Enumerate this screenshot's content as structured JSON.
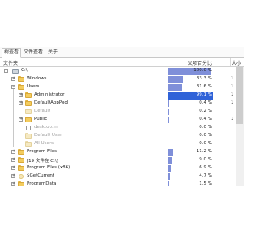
{
  "tabs": [
    "树查看",
    "文件查看",
    "关于"
  ],
  "columns": {
    "folder": "文件夹",
    "parent_pct": "父项百分比",
    "size": "大小"
  },
  "rows": [
    {
      "name": "C:\\",
      "pct": "100.0 %",
      "fraction": 1.0,
      "size": "",
      "icon": "drive-icon",
      "indent": 0,
      "expander": "−",
      "selected": false,
      "faded": false
    },
    {
      "name": "Windows",
      "pct": "33.3 %",
      "fraction": 0.333,
      "size": "1",
      "icon": "folder-icon",
      "indent": 1,
      "expander": "+",
      "selected": false,
      "faded": false
    },
    {
      "name": "Users",
      "pct": "31.6 %",
      "fraction": 0.316,
      "size": "1",
      "icon": "folder-icon",
      "indent": 1,
      "expander": "−",
      "selected": false,
      "faded": false
    },
    {
      "name": "Administrator",
      "pct": "99.1 %",
      "fraction": 0.991,
      "size": "1",
      "icon": "folder-icon",
      "indent": 2,
      "expander": "+",
      "selected": true,
      "faded": false
    },
    {
      "name": "DefaultAppPool",
      "pct": "0.4 %",
      "fraction": 0.004,
      "size": "1",
      "icon": "folder-icon",
      "indent": 2,
      "expander": "+",
      "selected": false,
      "faded": false
    },
    {
      "name": "Default",
      "pct": "0.2 %",
      "fraction": 0.002,
      "size": "",
      "icon": "faded-folder-icon",
      "indent": 2,
      "expander": "",
      "selected": false,
      "faded": true
    },
    {
      "name": "Public",
      "pct": "0.4 %",
      "fraction": 0.004,
      "size": "1",
      "icon": "folder-icon",
      "indent": 2,
      "expander": "+",
      "selected": false,
      "faded": false
    },
    {
      "name": "desktop.ini",
      "pct": "0.0 %",
      "fraction": 0.0,
      "size": "",
      "icon": "file-icon",
      "indent": 2,
      "expander": "",
      "selected": false,
      "faded": true
    },
    {
      "name": "Default User",
      "pct": "0.0 %",
      "fraction": 0.0,
      "size": "",
      "icon": "faded-folder-icon",
      "indent": 2,
      "expander": "",
      "selected": false,
      "faded": true
    },
    {
      "name": "All Users",
      "pct": "0.0 %",
      "fraction": 0.0,
      "size": "",
      "icon": "faded-folder-icon",
      "indent": 2,
      "expander": "",
      "selected": false,
      "faded": true
    },
    {
      "name": "Program Files",
      "pct": "11.2 %",
      "fraction": 0.112,
      "size": "",
      "icon": "folder-icon",
      "indent": 1,
      "expander": "+",
      "selected": false,
      "faded": false
    },
    {
      "name": "[19 文件在 C:\\]",
      "pct": "9.0 %",
      "fraction": 0.09,
      "size": "",
      "icon": "files-icon",
      "indent": 1,
      "expander": "+",
      "selected": false,
      "faded": false
    },
    {
      "name": "Program Files (x86)",
      "pct": "6.9 %",
      "fraction": 0.069,
      "size": "",
      "icon": "folder-icon",
      "indent": 1,
      "expander": "+",
      "selected": false,
      "faded": false
    },
    {
      "name": "$GetCurrent",
      "pct": "4.7 %",
      "fraction": 0.047,
      "size": "",
      "icon": "gear-icon",
      "indent": 1,
      "expander": "+",
      "selected": false,
      "faded": false
    },
    {
      "name": "ProgramData",
      "pct": "1.5 %",
      "fraction": 0.015,
      "size": "",
      "icon": "folder-icon",
      "indent": 1,
      "expander": "+",
      "selected": false,
      "faded": false
    }
  ]
}
